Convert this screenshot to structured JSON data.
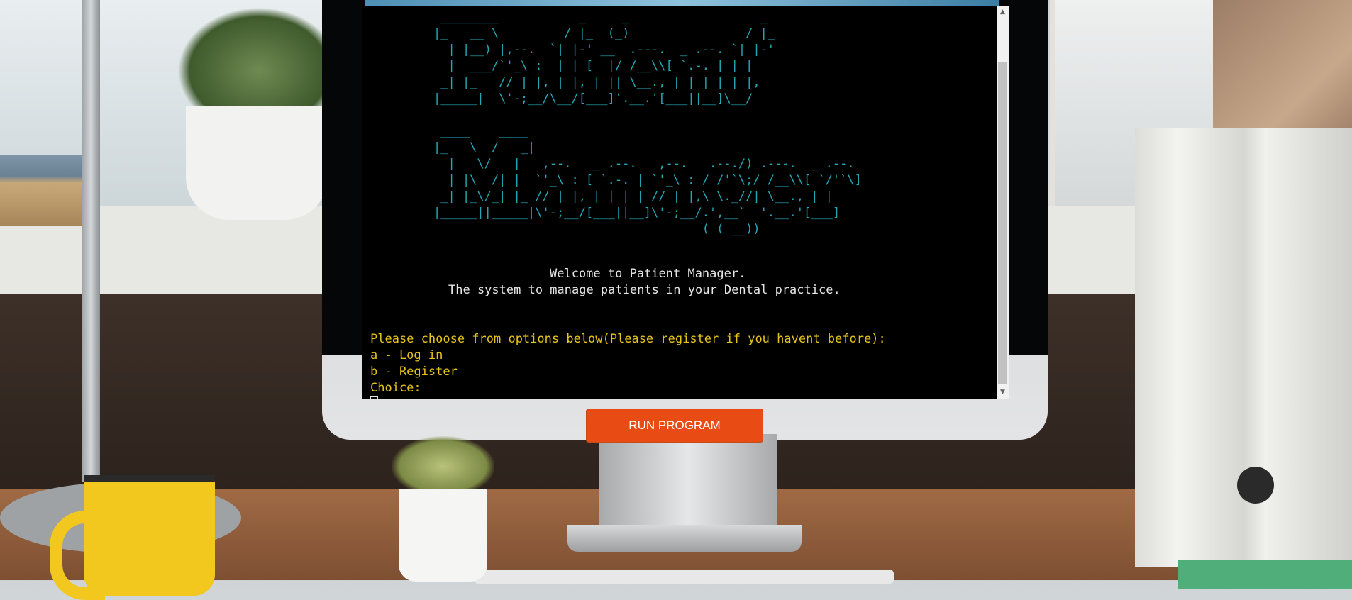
{
  "terminal": {
    "ascii_title_lines": [
      " ________           _     _                  _",
      "|_   __ \\         / |_  (_)                / |_",
      "  | |__) |,--.  `| |-' __  .---.  _ .--. `| |-'",
      "  |  ___/`'_\\ :  | | [  |/ /__\\\\[ `.-. | | |",
      " _| |_   // | |, | |, | || \\__., | | | | | |,",
      "|_____|  \\'-;__/\\__/[___]'.__.'[___||__]\\__/",
      "",
      " ____    ____",
      "|_   \\  /   _|",
      "  |   \\/   |   ,--.   _ .--.   ,--.   .--./) .---.  _ .--.",
      "  | |\\  /| |  `'_\\ : [ `.-. | `'_\\ : / /'`\\;/ /__\\\\[ `/'`\\]",
      " _| |_\\/_| |_ // | |, | | | | // | |,\\ \\._//| \\__., | |",
      "|_____||_____|\\'-;__/[___||__]\\'-;__/.',__`  '.__.'[___]",
      "                                     ( ( __))"
    ],
    "welcome_line": "Welcome to Patient Manager.",
    "subtitle_line": "The system to manage patients in your Dental practice.",
    "prompt_line": "Please choose from options below(Please register if you havent before):",
    "option_a": "a - Log in",
    "option_b": "b - Register",
    "choice_label": "Choice:"
  },
  "run_button_label": "RUN PROGRAM",
  "colors": {
    "ascii": "#23a7b4",
    "prompt": "#e6c41b",
    "button": "#e84b13"
  }
}
